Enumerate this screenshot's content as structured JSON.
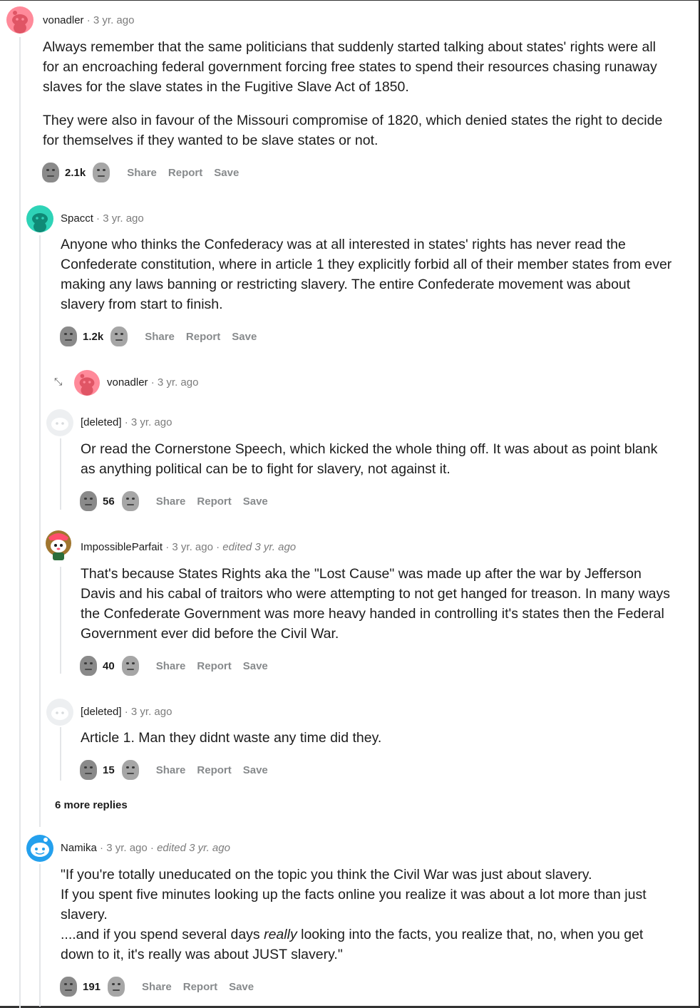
{
  "comments": [
    {
      "user": "vonadler",
      "age": "3 yr. ago",
      "paragraphs": [
        "Always remember that the same politicians that suddenly started talking about states' rights were all for an encroaching federal government forcing free states to spend their resources chasing runaway slaves for the slave states in the Fugitive Slave Act of 1850.",
        "They were also in favour of the Missouri compromise of 1820, which denied states the right to decide for themselves if they wanted to be slave states or not."
      ],
      "score": "2.1k",
      "avatar_color": "#ff8a9a"
    },
    {
      "user": "Spacct",
      "age": "3 yr. ago",
      "paragraphs": [
        "Anyone who thinks the Confederacy was at all interested in states' rights has never read the Confederate constitution, where in article 1 they explicitly forbid all of their member states from ever making any laws banning or restricting slavery. The entire Confederate movement was about slavery from start to finish."
      ],
      "score": "1.2k",
      "avatar_color": "#2ed3b7"
    },
    {
      "user": "vonadler",
      "age": "3 yr. ago",
      "collapsed": true,
      "avatar_color": "#ff8a9a"
    },
    {
      "user": "[deleted]",
      "age": "3 yr. ago",
      "paragraphs": [
        "Or read the Cornerstone Speech, which kicked the whole thing off. It was about as point blank as anything political can be to fight for slavery, not against it."
      ],
      "score": "56",
      "avatar_color": "#d7dadc"
    },
    {
      "user": "ImpossibleParfait",
      "age": "3 yr. ago",
      "edited": "edited 3 yr. ago",
      "paragraphs": [
        "That's because States Rights aka the \"Lost Cause\" was made up after the war by Jefferson Davis and his cabal of traitors who were attempting to not get hanged for treason. In many ways the Confederate Government was more heavy handed in controlling it's states then the Federal Government ever did before the Civil War."
      ],
      "score": "40",
      "avatar_color": "#ff4f6d"
    },
    {
      "user": "[deleted]",
      "age": "3 yr. ago",
      "paragraphs": [
        "Article 1. Man they didnt waste any time did they."
      ],
      "score": "15",
      "avatar_color": "#d7dadc"
    },
    {
      "user": "Namika",
      "age": "3 yr. ago",
      "edited": "edited 3 yr. ago",
      "lines": [
        "\"If you're totally uneducated on the topic you think the Civil War was just about slavery.",
        "If you spent five minutes looking up the facts online you realize it was about a lot more than just slavery.",
        "....and if you spend several days ",
        "really",
        " looking into the facts, you realize that, no, when you get down to it, it's really was about JUST slavery.\""
      ],
      "score": "191",
      "avatar_color": "#24a0ed"
    }
  ],
  "actions": {
    "share": "Share",
    "report": "Report",
    "save": "Save"
  },
  "more_replies": "6 more replies",
  "separator": "·",
  "icons": {
    "upvote": "upvote-face-icon",
    "downvote": "downvote-face-icon",
    "expand": "expand-arrows-icon"
  }
}
